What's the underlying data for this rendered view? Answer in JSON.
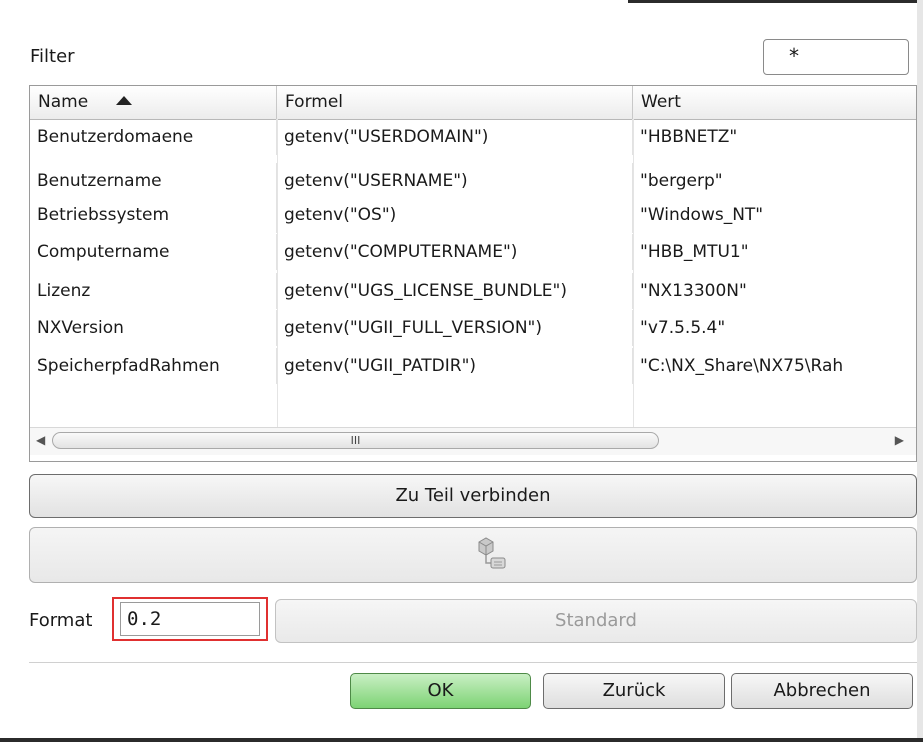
{
  "filter": {
    "label": "Filter",
    "value": "*"
  },
  "table": {
    "columns": [
      "Name",
      "Formel",
      "Wert"
    ],
    "sort_column": "Name",
    "rows": [
      [
        "Benutzerdomaene",
        "getenv(\"USERDOMAIN\")",
        "\"HBBNETZ\""
      ],
      [
        "Benutzername",
        "getenv(\"USERNAME\")",
        "\"bergerp\""
      ],
      [
        "Betriebssystem",
        "getenv(\"OS\")",
        "\"Windows_NT\""
      ],
      [
        "Computername",
        "getenv(\"COMPUTERNAME\")",
        "\"HBB_MTU1\""
      ],
      [
        "Lizenz",
        "getenv(\"UGS_LICENSE_BUNDLE\")",
        "\"NX13300N\""
      ],
      [
        "NXVersion",
        "getenv(\"UGII_FULL_VERSION\")",
        "\"v7.5.5.4\""
      ],
      [
        "SpeicherpfadRahmen",
        "getenv(\"UGII_PATDIR\")",
        "\"C:\\NX_Share\\NX75\\Rah"
      ]
    ],
    "scrollbar_grip": "III"
  },
  "buttons": {
    "connect": "Zu Teil verbinden",
    "standard": "Standard",
    "ok": "OK",
    "back": "Zurück",
    "cancel": "Abbrechen"
  },
  "format": {
    "label": "Format",
    "value": "0.2"
  },
  "icons": {
    "sort": "sort-ascending-icon",
    "scroll_left": "scroll-left-icon",
    "scroll_right": "scroll-right-icon",
    "component": "component-link-icon"
  },
  "colors": {
    "ok_button": "#7dd374",
    "format_highlight": "#e03030"
  }
}
